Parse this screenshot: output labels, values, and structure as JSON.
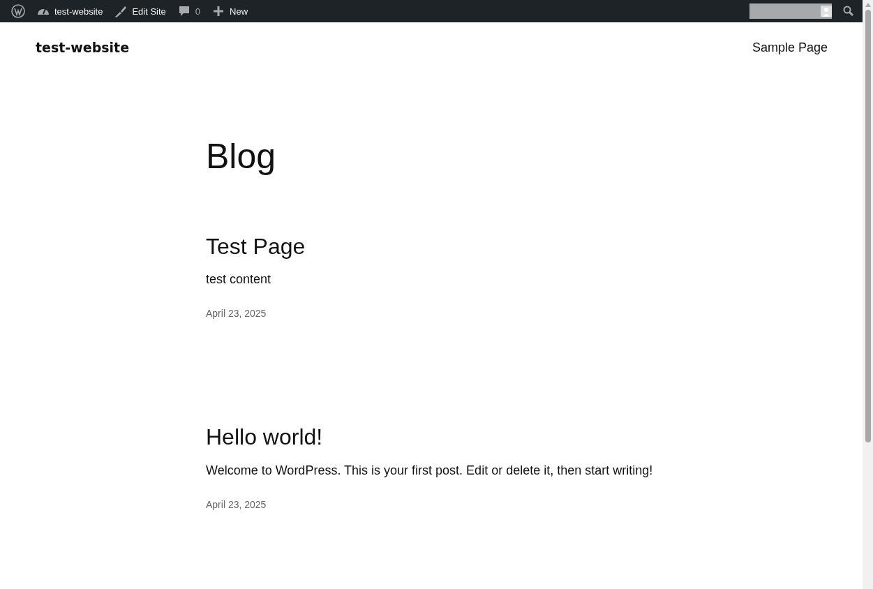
{
  "admin_bar": {
    "site_name": "test-website",
    "edit_site": "Edit Site",
    "comments_count": "0",
    "new_label": "New"
  },
  "header": {
    "site_title": "test-website",
    "nav": [
      "Sample Page"
    ]
  },
  "page_title": "Blog",
  "posts": [
    {
      "title": "Test Page",
      "excerpt": "test content",
      "date": "April 23, 2025"
    },
    {
      "title": "Hello world!",
      "excerpt": "Welcome to WordPress. This is your first post. Edit or delete it, then start writing!",
      "date": "April 23, 2025"
    }
  ]
}
